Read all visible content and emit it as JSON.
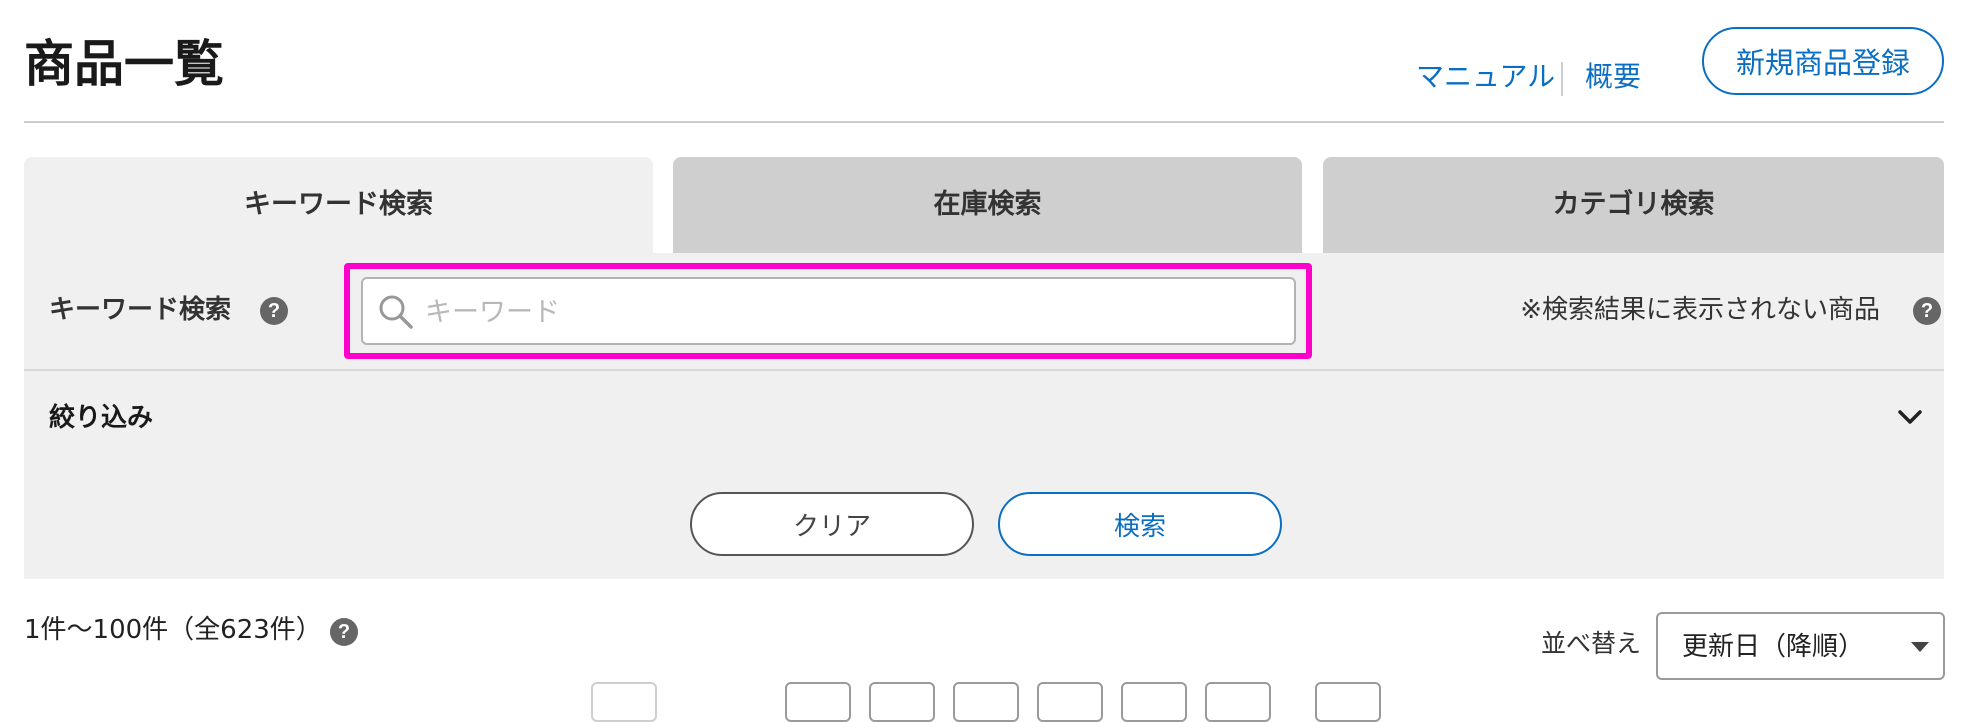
{
  "header": {
    "title": "商品一覧",
    "links": {
      "manual": "マニュアル",
      "overview": "概要"
    },
    "register_button": "新規商品登録"
  },
  "tabs": [
    {
      "label": "キーワード検索",
      "active": true
    },
    {
      "label": "在庫検索",
      "active": false
    },
    {
      "label": "カテゴリ検索",
      "active": false
    }
  ],
  "search": {
    "keyword_label": "キーワード検索",
    "keyword_placeholder": "キーワード",
    "keyword_value": "",
    "note": "※検索結果に表示されない商品",
    "help_glyph": "?"
  },
  "filter": {
    "label": "絞り込み",
    "expanded": false
  },
  "buttons": {
    "clear": "クリア",
    "search": "検索"
  },
  "results": {
    "count_text": "1件～100件（全623件）"
  },
  "sort": {
    "label": "並べ替え",
    "selected": "更新日（降順）"
  },
  "colors": {
    "accent": "#0a6fc2",
    "highlight": "#ff00cc",
    "panel_bg": "#f0f0f0",
    "inactive_tab": "#cfcfcf"
  },
  "icons": [
    "help-icon",
    "search-icon",
    "chevron-down-icon",
    "caret-down-icon"
  ]
}
